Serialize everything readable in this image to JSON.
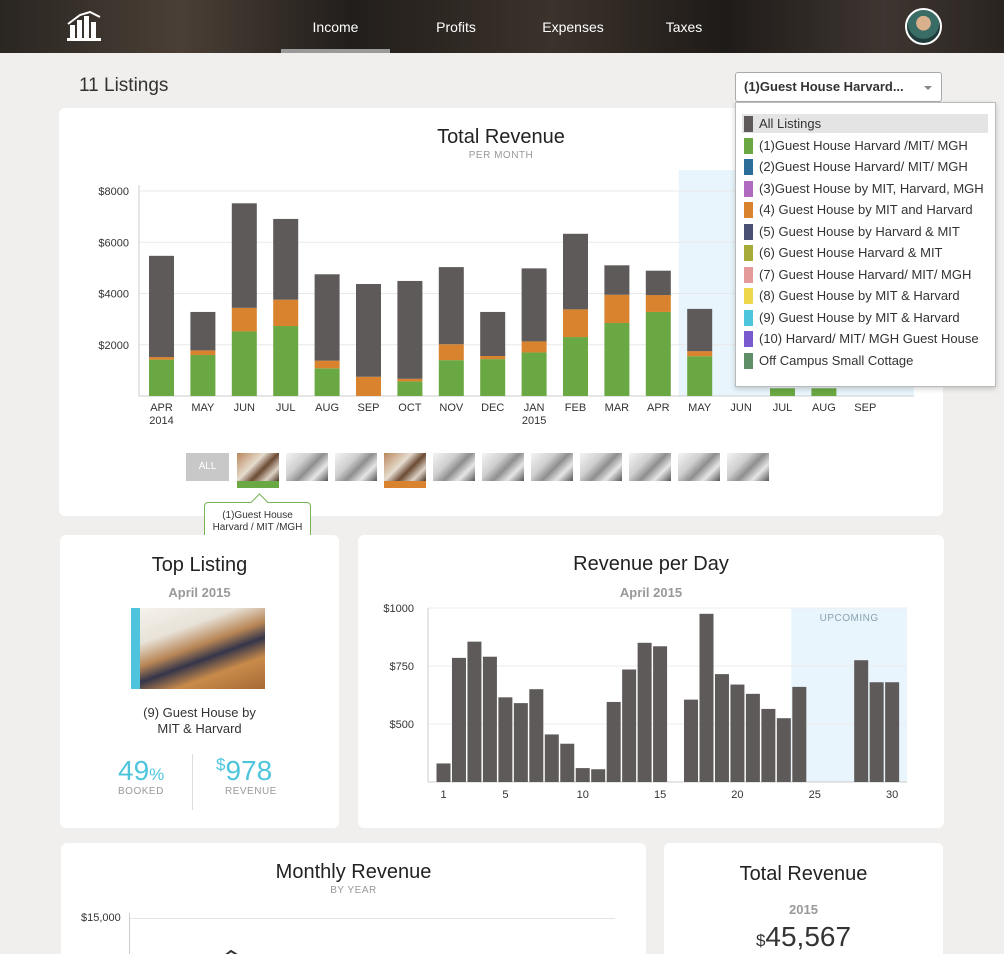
{
  "nav": {
    "tabs": [
      {
        "label": "Income",
        "active": true
      },
      {
        "label": "Profits",
        "active": false
      },
      {
        "label": "Expenses",
        "active": false
      },
      {
        "label": "Taxes",
        "active": false
      }
    ],
    "logo_icon": "bar-chart-logo-icon",
    "avatar_icon": "user-avatar"
  },
  "listings_count_label": "11 Listings",
  "listing_select": {
    "selected": "(1)Guest House Harvard...",
    "options": [
      {
        "label": "All Listings",
        "color": "#5f5a5a"
      },
      {
        "label": "(1)Guest House Harvard /MIT/ MGH",
        "color": "#6aa843"
      },
      {
        "label": "(2)Guest House Harvard/ MIT/ MGH",
        "color": "#2c6d9a"
      },
      {
        "label": "(3)Guest House by MIT, Harvard, MGH",
        "color": "#b06ac0"
      },
      {
        "label": "(4) Guest House by MIT and Harvard",
        "color": "#d9832e"
      },
      {
        "label": "(5) Guest House by Harvard & MIT",
        "color": "#4a4f74"
      },
      {
        "label": "(6) Guest House Harvard & MIT",
        "color": "#a6ab3a"
      },
      {
        "label": "(7) Guest House Harvard/ MIT/ MGH",
        "color": "#e59a9a"
      },
      {
        "label": "(8) Guest House by MIT & Harvard",
        "color": "#ecd84a"
      },
      {
        "label": "(9) Guest House by MIT & Harvard",
        "color": "#4ec5dc"
      },
      {
        "label": "(10) Harvard/ MIT/ MGH Guest House",
        "color": "#7a5acf"
      },
      {
        "label": "Off Campus Small Cottage",
        "color": "#5e8f66"
      }
    ]
  },
  "total_revenue_card": {
    "title": "Total Revenue",
    "subtitle": "PER MONTH"
  },
  "thumb_strip": {
    "all_label": "ALL",
    "tooltip_line1": "(1)Guest House",
    "tooltip_line2": "Harvard / MIT /MGH"
  },
  "top_listing": {
    "title": "Top Listing",
    "period": "April 2015",
    "name_line1": "(9) Guest House by",
    "name_line2": "MIT & Harvard",
    "booked_value": "49",
    "booked_unit": "%",
    "booked_label": "BOOKED",
    "revenue_currency": "$",
    "revenue_value": "978",
    "revenue_label": "REVENUE"
  },
  "revenue_per_day_card": {
    "title": "Revenue per Day",
    "period": "April 2015",
    "upcoming_label": "UPCOMING"
  },
  "monthly_revenue_card": {
    "title": "Monthly Revenue",
    "subtitle": "BY YEAR",
    "ytick": "$15,000"
  },
  "total_revenue_year_card": {
    "title": "Total Revenue",
    "year": "2015",
    "currency": "$",
    "value": "45,567"
  },
  "chart_data": [
    {
      "type": "bar",
      "title": "Total Revenue",
      "subtitle": "PER MONTH",
      "stacked": true,
      "categories": [
        "APR\n2014",
        "MAY",
        "JUN",
        "JUL",
        "AUG",
        "SEP",
        "OCT",
        "NOV",
        "DEC",
        "JAN\n2015",
        "FEB",
        "MAR",
        "APR",
        "MAY",
        "JUN",
        "JUL",
        "AUG",
        "SEP"
      ],
      "series": [
        {
          "color": "#6aa843",
          "values": [
            1420,
            1600,
            2520,
            2730,
            1080,
            0,
            570,
            1400,
            1440,
            1700,
            2300,
            2850,
            3280,
            1550,
            0,
            300,
            300,
            0
          ]
        },
        {
          "color": "#d9832e",
          "values": [
            100,
            180,
            920,
            1030,
            300,
            750,
            100,
            620,
            120,
            430,
            1080,
            1100,
            660,
            200,
            0,
            0,
            0,
            0
          ]
        },
        {
          "color": "#5f5a5a",
          "values": [
            3950,
            1500,
            4080,
            3150,
            3370,
            3620,
            3820,
            3010,
            1720,
            2850,
            2950,
            1150,
            950,
            1650,
            0,
            0,
            0,
            0
          ]
        }
      ],
      "ylabel": "",
      "yticks": [
        "$2000",
        "$4000",
        "$6000",
        "$8000"
      ],
      "ylim": [
        0,
        8000
      ],
      "upcoming_from": "MAY (2015)",
      "grid": true
    },
    {
      "type": "bar",
      "title": "Revenue per Day",
      "subtitle": "April 2015",
      "x": [
        1,
        2,
        3,
        4,
        5,
        6,
        7,
        8,
        9,
        10,
        11,
        12,
        13,
        14,
        15,
        16,
        17,
        18,
        19,
        20,
        21,
        22,
        23,
        24,
        25,
        26,
        27,
        28,
        29,
        30
      ],
      "values": [
        330,
        785,
        855,
        790,
        615,
        590,
        650,
        455,
        415,
        310,
        305,
        595,
        735,
        850,
        835,
        null,
        605,
        975,
        715,
        670,
        630,
        565,
        525,
        660,
        null,
        null,
        null,
        775,
        680,
        680
      ],
      "xticks": [
        1,
        5,
        10,
        15,
        20,
        25,
        30
      ],
      "yticks": [
        "$500",
        "$750",
        "$1000"
      ],
      "ylim": [
        250,
        1000
      ],
      "upcoming_label": "UPCOMING",
      "upcoming_from_day": 24,
      "color": "#5f5a5a"
    }
  ]
}
